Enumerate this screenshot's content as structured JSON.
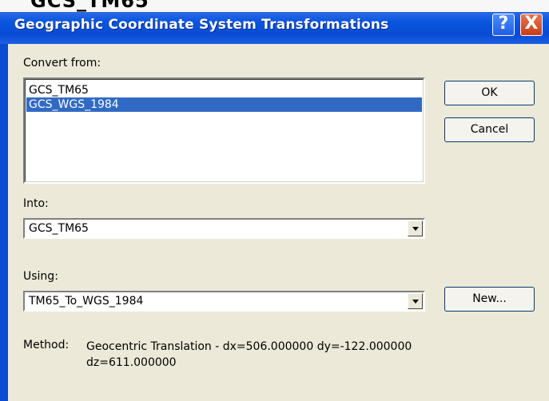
{
  "window": {
    "top_sliver_text": "GCS_TM65",
    "title": "Geographic Coordinate System Transformations",
    "help_label": "?",
    "close_label": "X"
  },
  "convert_from": {
    "label": "Convert from:",
    "items": [
      {
        "text": "GCS_TM65",
        "selected": false
      },
      {
        "text": "GCS_WGS_1984",
        "selected": true
      }
    ]
  },
  "buttons": {
    "ok": "OK",
    "cancel": "Cancel",
    "new": "New..."
  },
  "into": {
    "label": "Into:",
    "value": "GCS_TM65"
  },
  "using": {
    "label": "Using:",
    "value": "TM65_To_WGS_1984"
  },
  "method": {
    "label": "Method:",
    "value": "Geocentric Translation - dx=506.000000 dy=-122.000000 dz=611.000000"
  },
  "colors": {
    "title_bar": "#0a4bd2",
    "selection": "#316ac5",
    "dialog_bg": "#ece9d8"
  }
}
